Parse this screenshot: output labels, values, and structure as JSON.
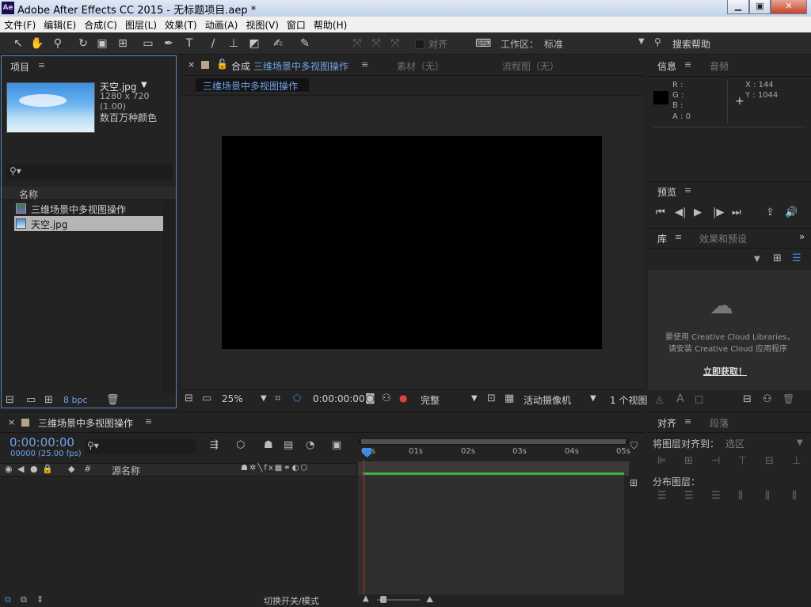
{
  "window": {
    "title": "Adobe After Effects CC 2015 - 无标题项目.aep *",
    "logo": "Ae",
    "min": "▁",
    "max": "▣",
    "close": "✕"
  },
  "menu": [
    "文件(F)",
    "编辑(E)",
    "合成(C)",
    "图层(L)",
    "效果(T)",
    "动画(A)",
    "视图(V)",
    "窗口",
    "帮助(H)"
  ],
  "toolbar": {
    "align_label": "对齐",
    "workspace_label": "工作区：",
    "workspace_value": "标准",
    "search_help": "搜索帮助"
  },
  "project": {
    "title": "项目",
    "asset_name": "天空.jpg",
    "asset_dims": "1280 x 720 (1.00)",
    "asset_colors": "数百万种颜色",
    "col_name": "名称",
    "items": [
      "三维场景中多视图操作",
      "天空.jpg"
    ],
    "bpc": "8 bpc"
  },
  "comp": {
    "tab_prefix": "合成",
    "tab_name": "三维场景中多视图操作",
    "footage_tab": "素材（无）",
    "flow_tab": "流程图（无）",
    "crumb": "三维场景中多视图操作",
    "zoom": "25%",
    "timecode": "0:00:00:00",
    "quality": "完整",
    "camera": "活动摄像机",
    "views": "1 个视图"
  },
  "info": {
    "tab": "信息",
    "audio_tab": "音频",
    "r": "R :",
    "g": "G :",
    "b": "B :",
    "a": "A : 0",
    "x": "X : 144",
    "y": "Y : 1044"
  },
  "preview": {
    "tab": "预览"
  },
  "library": {
    "tab": "库",
    "effects_tab": "效果和预设",
    "msg1": "要使用 Creative Cloud Libraries，",
    "msg2": "请安装 Creative Cloud 应用程序",
    "cta": "立即获取！"
  },
  "timeline": {
    "comp_name": "三维场景中多视图操作",
    "timecode": "0:00:00:00",
    "fps": "00000 (25.00 fps)",
    "col_source": "源名称",
    "ruler": [
      "00s",
      "01s",
      "02s",
      "03s",
      "04s",
      "05s"
    ],
    "toggle": "切换开关/模式"
  },
  "align": {
    "tab": "对齐",
    "para_tab": "段落",
    "align_to_label": "将图层对齐到：",
    "align_to_value": "选区",
    "distribute_label": "分布图层："
  }
}
